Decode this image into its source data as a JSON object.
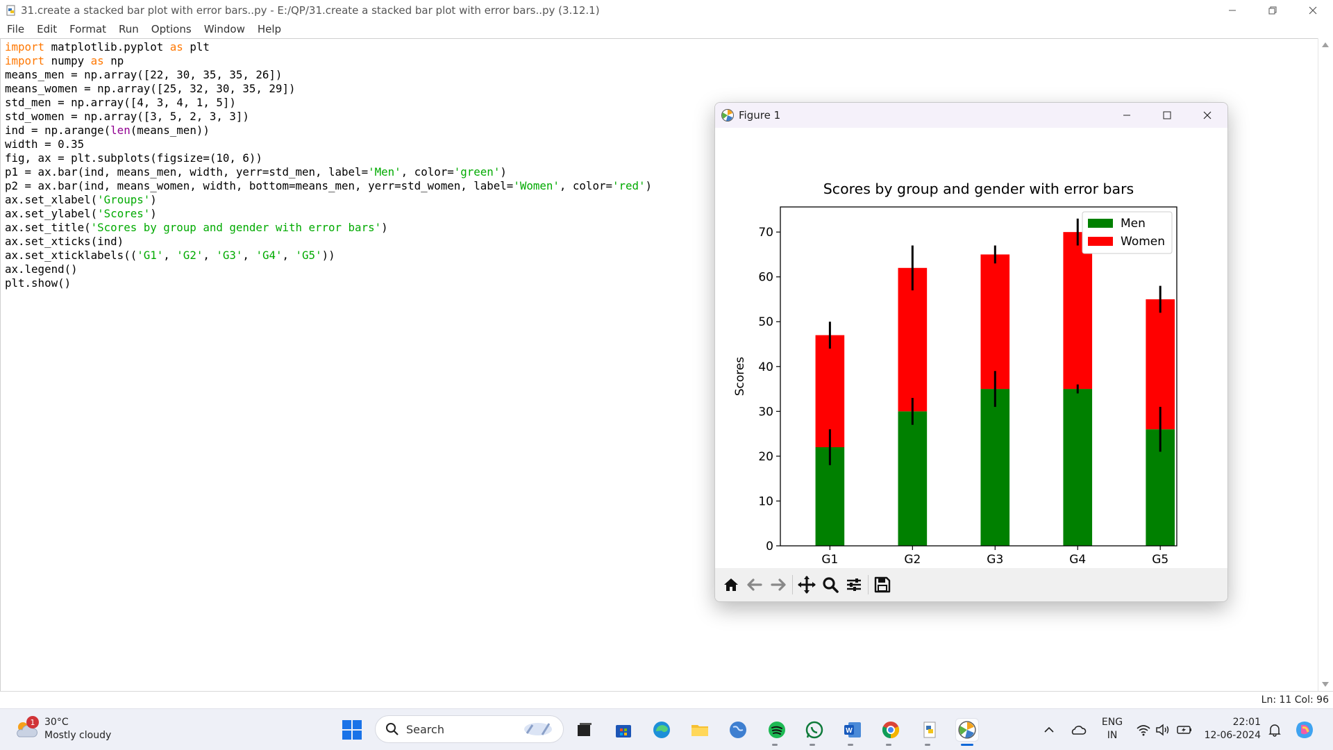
{
  "window": {
    "title": "31.create a stacked bar plot with error bars..py - E:/QP/31.create a stacked bar plot with error bars..py (3.12.1)"
  },
  "menu": [
    "File",
    "Edit",
    "Format",
    "Run",
    "Options",
    "Window",
    "Help"
  ],
  "code_lines": [
    [
      {
        "t": "import",
        "c": "kw"
      },
      {
        "t": " matplotlib.pyplot "
      },
      {
        "t": "as",
        "c": "kw"
      },
      {
        "t": " plt"
      }
    ],
    [
      {
        "t": "import",
        "c": "kw"
      },
      {
        "t": " numpy "
      },
      {
        "t": "as",
        "c": "kw"
      },
      {
        "t": " np"
      }
    ],
    [
      {
        "t": "means_men = np.array([22, 30, 35, 35, 26])"
      }
    ],
    [
      {
        "t": "means_women = np.array([25, 32, 30, 35, 29])"
      }
    ],
    [
      {
        "t": "std_men = np.array([4, 3, 4, 1, 5])"
      }
    ],
    [
      {
        "t": "std_women = np.array([3, 5, 2, 3, 3])"
      }
    ],
    [
      {
        "t": "ind = np.arange("
      },
      {
        "t": "len",
        "c": "bi"
      },
      {
        "t": "(means_men))"
      }
    ],
    [
      {
        "t": "width = 0.35"
      }
    ],
    [
      {
        "t": "fig, ax = plt.subplots(figsize=(10, 6))"
      }
    ],
    [
      {
        "t": "p1 = ax.bar(ind, means_men, width, yerr=std_men, label="
      },
      {
        "t": "'Men'",
        "c": "st"
      },
      {
        "t": ", color="
      },
      {
        "t": "'green'",
        "c": "st"
      },
      {
        "t": ")"
      }
    ],
    [
      {
        "t": "p2 = ax.bar(ind, means_women, width, bottom=means_men, yerr=std_women, label="
      },
      {
        "t": "'Women'",
        "c": "st"
      },
      {
        "t": ", color="
      },
      {
        "t": "'red'",
        "c": "st"
      },
      {
        "t": ")"
      }
    ],
    [
      {
        "t": "ax.set_xlabel("
      },
      {
        "t": "'Groups'",
        "c": "st"
      },
      {
        "t": ")"
      }
    ],
    [
      {
        "t": "ax.set_ylabel("
      },
      {
        "t": "'Scores'",
        "c": "st"
      },
      {
        "t": ")"
      }
    ],
    [
      {
        "t": "ax.set_title("
      },
      {
        "t": "'Scores by group and gender with error bars'",
        "c": "st"
      },
      {
        "t": ")"
      }
    ],
    [
      {
        "t": "ax.set_xticks(ind)"
      }
    ],
    [
      {
        "t": "ax.set_xticklabels(("
      },
      {
        "t": "'G1'",
        "c": "st"
      },
      {
        "t": ", "
      },
      {
        "t": "'G2'",
        "c": "st"
      },
      {
        "t": ", "
      },
      {
        "t": "'G3'",
        "c": "st"
      },
      {
        "t": ", "
      },
      {
        "t": "'G4'",
        "c": "st"
      },
      {
        "t": ", "
      },
      {
        "t": "'G5'",
        "c": "st"
      },
      {
        "t": "))"
      }
    ],
    [
      {
        "t": "ax.legend()"
      }
    ],
    [
      {
        "t": "plt.show()"
      }
    ]
  ],
  "status": {
    "position": "Ln: 11   Col: 96"
  },
  "figure": {
    "window_title": "Figure 1",
    "toolbar": [
      "home-icon",
      "back-icon",
      "forward-icon",
      "pan-icon",
      "zoom-icon",
      "configure-icon",
      "save-icon"
    ]
  },
  "chart_data": {
    "type": "bar",
    "stacked": true,
    "title": "Scores by group and gender with error bars",
    "xlabel": "Groups",
    "ylabel": "Scores",
    "categories": [
      "G1",
      "G2",
      "G3",
      "G4",
      "G5"
    ],
    "series": [
      {
        "name": "Men",
        "color": "#008000",
        "values": [
          22,
          30,
          35,
          35,
          26
        ],
        "errors": [
          4,
          3,
          4,
          1,
          5
        ]
      },
      {
        "name": "Women",
        "color": "#ff0000",
        "values": [
          25,
          32,
          30,
          35,
          29
        ],
        "errors": [
          3,
          5,
          2,
          3,
          3
        ]
      }
    ],
    "yticks": [
      0,
      10,
      20,
      30,
      40,
      50,
      60,
      70
    ],
    "ylim": [
      0,
      75.6
    ],
    "xlim": [
      -0.6,
      4.2
    ],
    "bar_width": 0.35,
    "legend": "top-right"
  },
  "weather": {
    "temp": "30°C",
    "condition": "Mostly cloudy",
    "badge": "1"
  },
  "taskbar": {
    "search_label": "Search",
    "lang_top": "ENG",
    "lang_bottom": "IN",
    "time": "22:01",
    "date": "12-06-2024"
  }
}
